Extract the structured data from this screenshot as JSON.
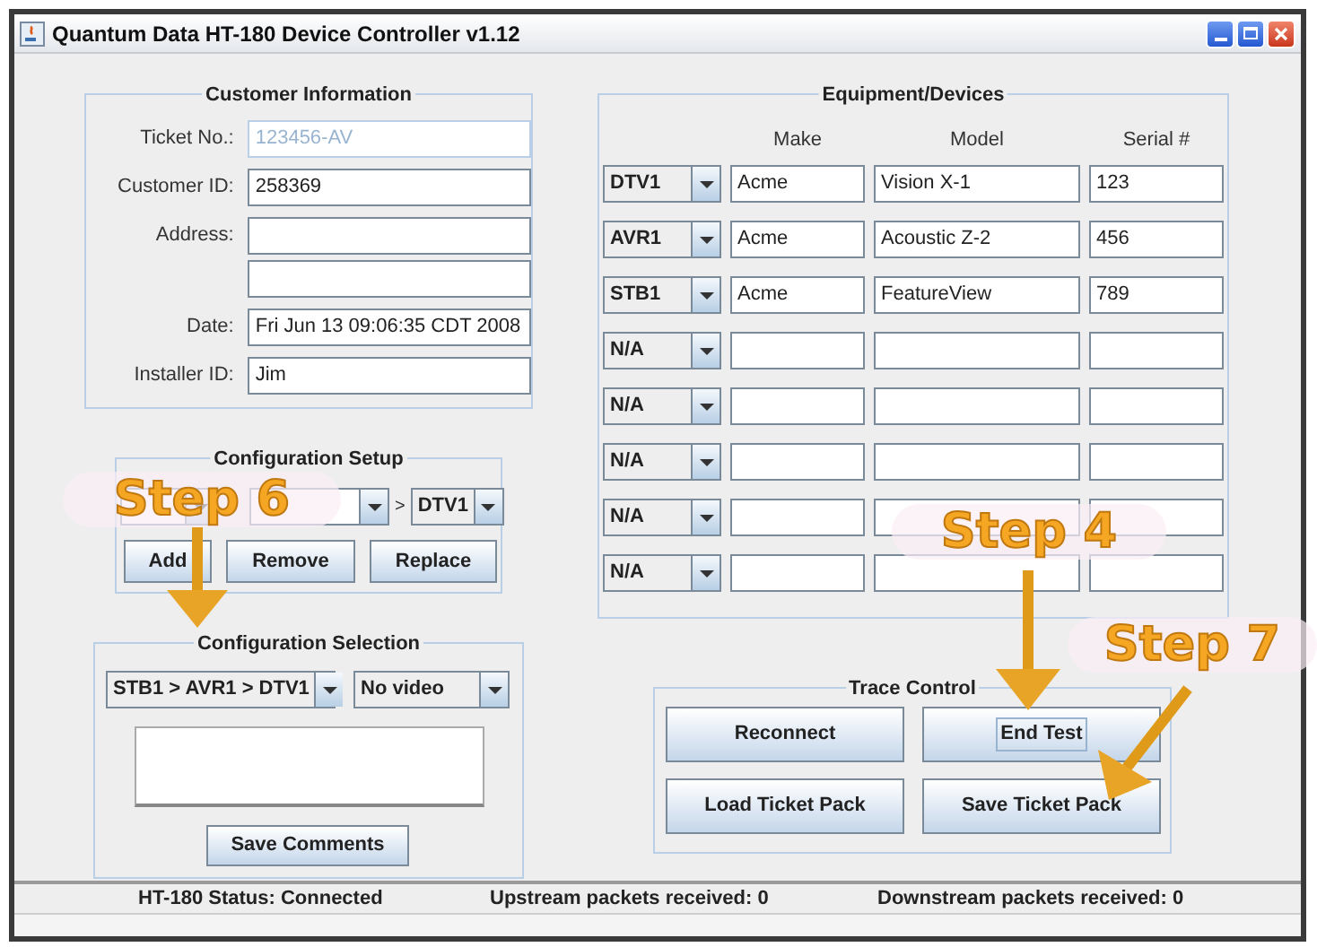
{
  "window": {
    "title": "Quantum Data HT-180 Device Controller v1.12"
  },
  "customer_information": {
    "title": "Customer Information",
    "fields": [
      {
        "label": "Ticket No.:",
        "value": "123456-AV",
        "disabled": true
      },
      {
        "label": "Customer ID:",
        "value": "258369",
        "disabled": false
      },
      {
        "label": "Address:",
        "disabled": false
      },
      {
        "disabled": false
      },
      {
        "label": "Date:",
        "value": "Fri Jun 13 09:06:35 CDT 2008",
        "disabled": false
      },
      {
        "label": "Installer ID:",
        "value": "Jim",
        "disabled": false
      }
    ]
  },
  "equipment_devices": {
    "title": "Equipment/Devices",
    "columns": [
      "Make",
      "Model",
      "Serial #"
    ],
    "rows": [
      {
        "device": "DTV1",
        "make": "Acme",
        "model": "Vision X-1",
        "serial": "123"
      },
      {
        "device": "AVR1",
        "make": "Acme",
        "model": "Acoustic Z-2",
        "serial": "456"
      },
      {
        "device": "STB1",
        "make": "Acme",
        "model": "FeatureView",
        "serial": "789"
      },
      {
        "device": "N/A"
      },
      {
        "device": "N/A"
      },
      {
        "device": "N/A"
      },
      {
        "device": "N/A"
      },
      {
        "device": "N/A"
      }
    ]
  },
  "configuration_setup": {
    "title": "Configuration Setup",
    "selects": [
      {
        "kind": "combo"
      },
      {
        "kind": "combo",
        "separator_after": ">"
      },
      {
        "value": "DTV1"
      }
    ],
    "buttons": [
      "Add",
      "Remove",
      "Replace"
    ]
  },
  "configuration_selection": {
    "title": "Configuration Selection",
    "chain": "STB1 > AVR1 > DTV1",
    "video": "No video",
    "button": "Save Comments"
  },
  "trace_control": {
    "title": "Trace Control",
    "buttons": [
      {
        "label": "Reconnect",
        "focused": false
      },
      {
        "label": "End Test",
        "focused": true
      },
      {
        "label": "Load Ticket Pack",
        "focused": false
      },
      {
        "label": "Save Ticket Pack",
        "focused": false
      }
    ]
  },
  "status_bar": [
    "HT-180 Status: Connected",
    "Upstream packets received: 0",
    "Downstream packets received: 0"
  ],
  "annotations": [
    {
      "label": "Step 6"
    },
    {
      "label": "Step 4"
    },
    {
      "label": "Step 7"
    }
  ]
}
